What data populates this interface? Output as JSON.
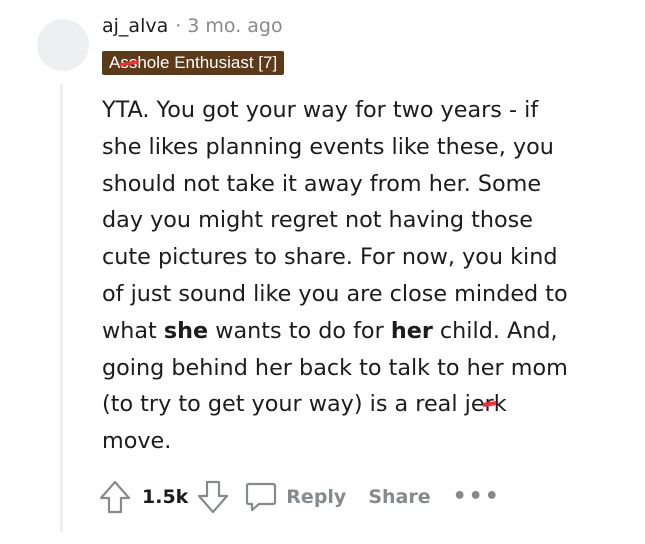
{
  "comment": {
    "username": "aj_alva",
    "separator": "·",
    "time": "3 mo. ago",
    "flair": {
      "prefix": "A",
      "censored": "ss",
      "suffix": "hole Enthusiast [7]"
    },
    "body_lines": [
      "YTA. You got your way for two years - if",
      "she likes planning events like these, you",
      "should not take it away from her. Some",
      "day you might regret not having those",
      "cute pictures to share. For now, you kind",
      "of just sound like you are close minded to"
    ],
    "line7": {
      "a": "what ",
      "b": "she",
      "c": " wants to do for ",
      "d": "her",
      "e": " child. And,"
    },
    "line8": "going behind her back to talk to her mom",
    "line9": {
      "a": "(to try to get your way) is a real je",
      "censored": "r",
      "b": "k"
    },
    "line10": "move.",
    "score": "1.5k",
    "reply_label": "Reply",
    "share_label": "Share",
    "more_label": "•••"
  },
  "icons": [
    "upvote-icon",
    "downvote-icon",
    "comment-bubble-icon",
    "more-options-icon"
  ],
  "colors": {
    "flair_bg": "#5c3a18",
    "muted": "#878a8c",
    "censor": "#ff2a2a",
    "thread_line": "#edeff1"
  }
}
